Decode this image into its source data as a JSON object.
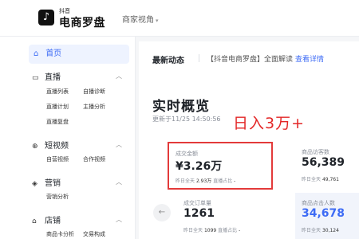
{
  "header": {
    "logo_small": "抖音",
    "logo_text": "电商罗盘",
    "role": "商家视角"
  },
  "sidebar": {
    "home": "首页",
    "sections": [
      {
        "title": "直播",
        "icon": "live-icon",
        "items": [
          "直播列表",
          "自播诊断",
          "直播计划",
          "主播分析",
          "直播复盘"
        ]
      },
      {
        "title": "短视频",
        "icon": "video-icon",
        "items": [
          "自营视频",
          "合作视频"
        ]
      },
      {
        "title": "营销",
        "icon": "marketing-icon",
        "items": [
          "营销分析"
        ]
      },
      {
        "title": "店铺",
        "icon": "store-icon",
        "items": [
          "商品卡分析",
          "交易构成"
        ]
      }
    ]
  },
  "main": {
    "dynamics_title": "最新动态",
    "dynamics_text": "【抖音电商罗盘】全面解读",
    "dynamics_link": "查看详情",
    "realtime_title": "实时概览",
    "updated": "更新于11/25 14:50:56",
    "annotation": "日入3万+",
    "metrics": [
      {
        "label": "成交金额",
        "value": "¥3.26万",
        "foot_a": "昨日全天",
        "foot_a_val": "2.93万",
        "foot_b": "直播占比",
        "foot_b_val": "-"
      },
      {
        "label": "商品访客数",
        "value": "56,389",
        "foot_a": "昨日全天",
        "foot_a_val": "49,761"
      },
      {
        "label": "成交订单量",
        "value": "1261",
        "foot_a": "昨日全天",
        "foot_a_val": "1099",
        "foot_b": "直播占比",
        "foot_b_val": "-"
      },
      {
        "label": "商品点击人数",
        "value": "34,678",
        "foot_a": "昨日全天",
        "foot_a_val": "30,124"
      }
    ]
  },
  "colors": {
    "accent": "#3d6bf5",
    "highlight": "#e33a3a"
  }
}
